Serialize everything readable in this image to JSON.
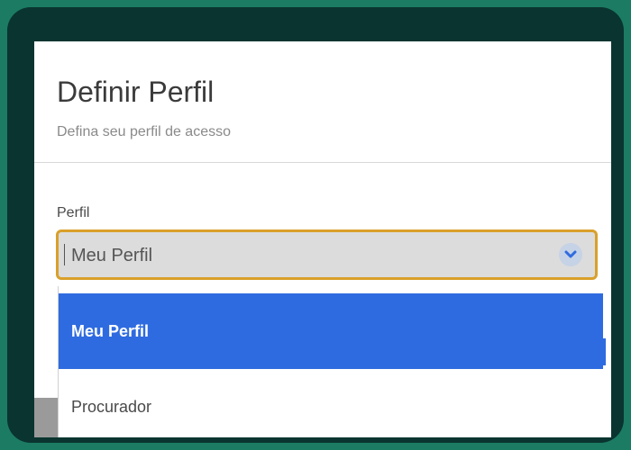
{
  "modal": {
    "title": "Definir Perfil",
    "subtitle": "Defina seu perfil de acesso"
  },
  "field": {
    "label": "Perfil",
    "selected_value": "Meu Perfil",
    "chevron_icon": "chevron-down-icon"
  },
  "dropdown": {
    "options": [
      {
        "label": "Meu Perfil",
        "selected": true
      },
      {
        "label": "Procurador",
        "selected": false
      }
    ]
  },
  "colors": {
    "background": "#1b7c63",
    "frame": "#0a3430",
    "focus_border": "#d9a02a",
    "selected_option": "#2f6be0"
  }
}
